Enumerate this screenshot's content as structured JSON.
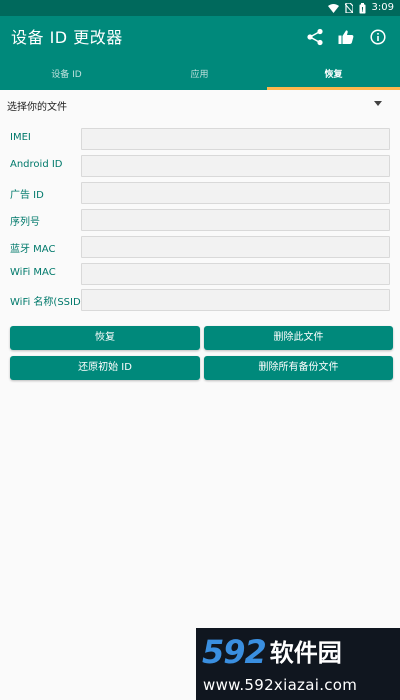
{
  "status_bar": {
    "time": "3:09",
    "icons": [
      "wifi-icon",
      "no-sim-icon",
      "battery-icon"
    ]
  },
  "app_bar": {
    "title": "设备 ID 更改器",
    "actions": [
      "share-icon",
      "thumbs-up-icon",
      "info-icon"
    ]
  },
  "tabs": [
    {
      "label": "设备 ID",
      "active": false
    },
    {
      "label": "应用",
      "active": false
    },
    {
      "label": "恢复",
      "active": true
    }
  ],
  "file_select": {
    "label": "选择你的文件"
  },
  "fields": [
    {
      "label": "IMEI",
      "value": ""
    },
    {
      "label": "Android ID",
      "value": ""
    },
    {
      "label": "广告 ID",
      "value": ""
    },
    {
      "label": "序列号",
      "value": ""
    },
    {
      "label": "蓝牙 MAC",
      "value": ""
    },
    {
      "label": "WiFi MAC",
      "value": ""
    },
    {
      "label": "WiFi 名称(SSID)",
      "value": ""
    }
  ],
  "buttons": {
    "restore": "恢复",
    "delete_file": "删除此文件",
    "reset_id": "还原初始 ID",
    "delete_all_backups": "删除所有备份文件"
  },
  "watermark": {
    "number": "592",
    "name": "软件园",
    "url": "www.592xiazai.com"
  },
  "colors": {
    "primary": "#00897b",
    "primary_dark": "#00695c",
    "accent": "#ffb74d",
    "label_text": "#00796b",
    "watermark_blue": "#3a8fe0",
    "watermark_bg": "#10161f"
  }
}
